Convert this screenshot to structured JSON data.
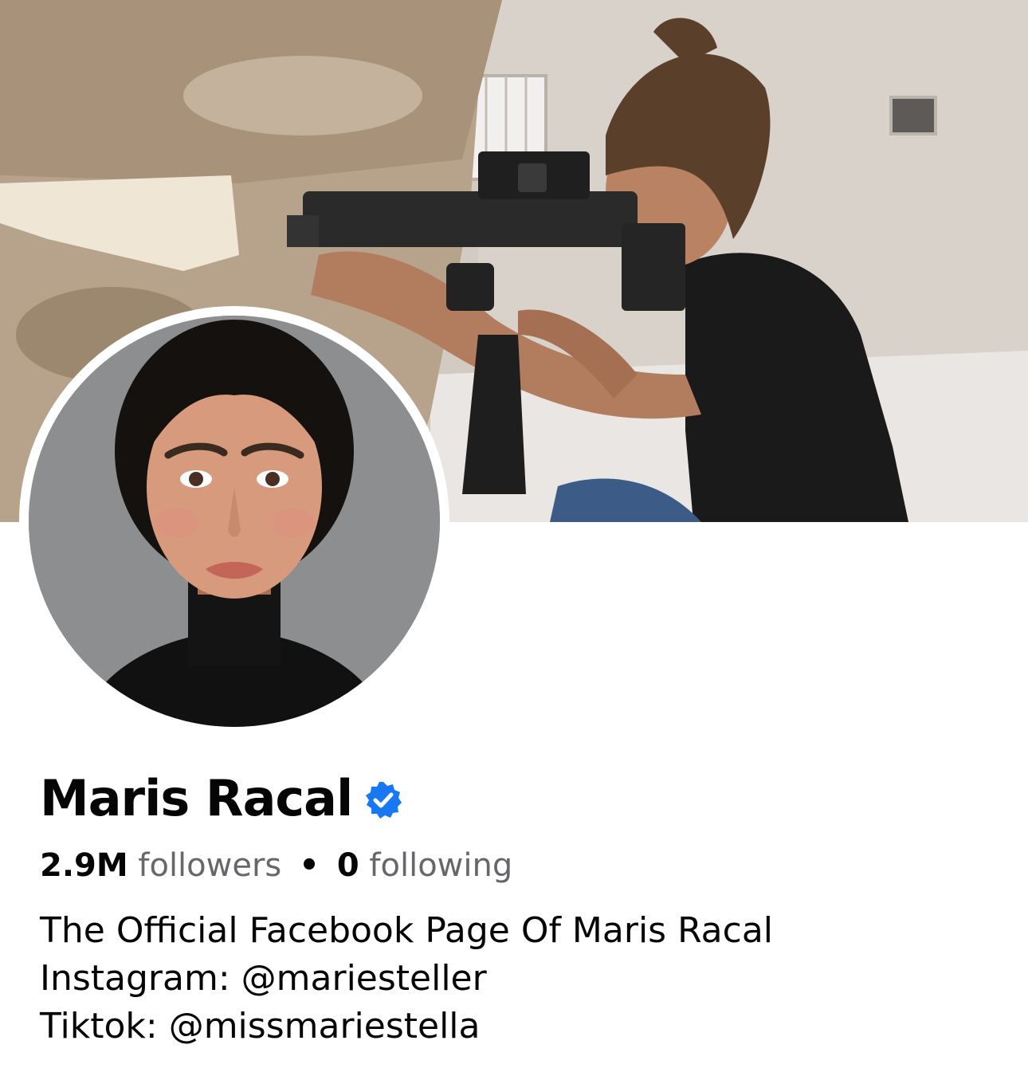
{
  "profile": {
    "name": "Maris Racal",
    "verified": true,
    "verified_color": "#1877f2",
    "followers_count": "2.9M",
    "followers_label": "followers",
    "separator": "•",
    "following_count": "0",
    "following_label": "following",
    "bio_lines": [
      "The Official Facebook Page Of Maris Racal",
      "Instagram: @mariesteller",
      "Tiktok: @missmariestella"
    ]
  },
  "icons": {
    "verified": "verified-badge-icon"
  },
  "colors": {
    "text_primary": "#050505",
    "text_secondary": "#65676b",
    "background": "#ffffff"
  }
}
